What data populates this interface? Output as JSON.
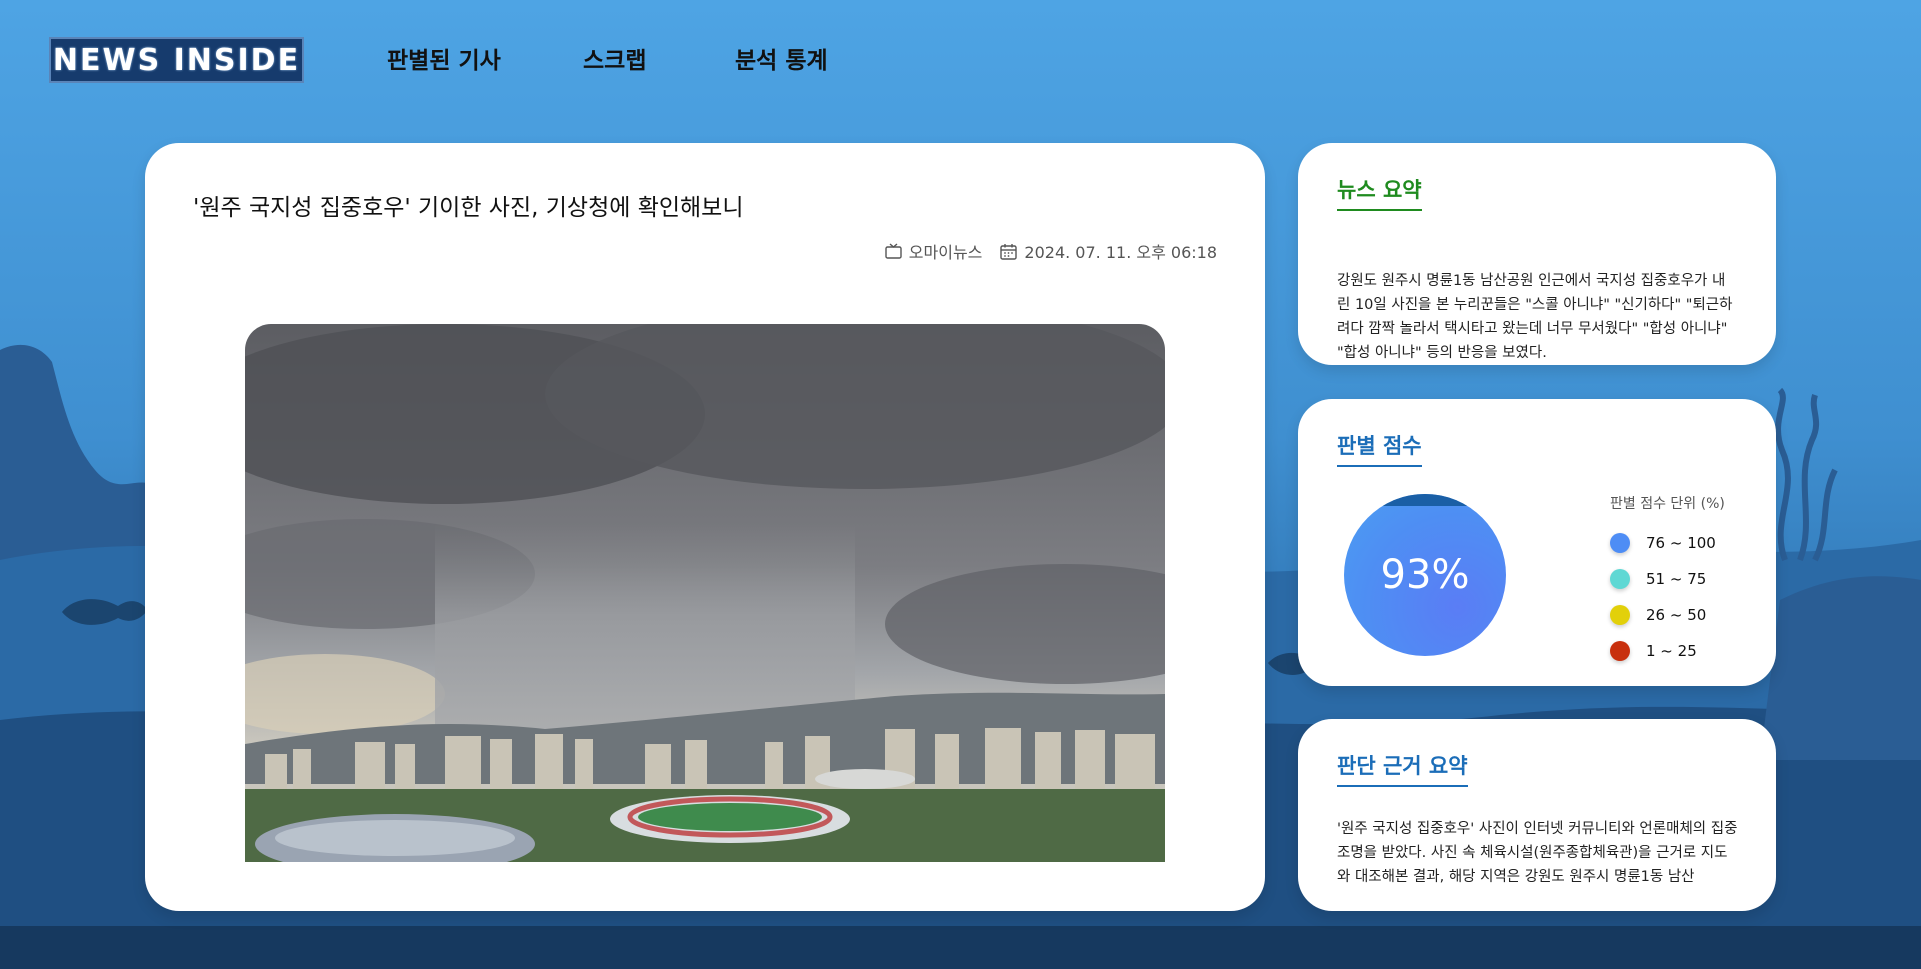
{
  "header": {
    "logo_text": "NEWS INSIDE",
    "nav": [
      "판별된 기사",
      "스크랩",
      "분석 통계"
    ]
  },
  "article": {
    "title": "'원주 국지성 집중호우' 기이한 사진, 기상청에 확인해보니",
    "source": "오마이뉴스",
    "datetime": "2024. 07. 11. 오후 06:18",
    "image_subject": "storm-cloud-rain-over-city-photo"
  },
  "summary_card": {
    "title": "뉴스 요약",
    "title_color": "#1f8b1f",
    "text": "강원도 원주시 명륜1동 남산공원 인근에서 국지성 집중호우가 내린 10일 사진을 본 누리꾼들은 \"스콜 아니냐\" \"신기하다\" \"퇴근하려다 깜짝 놀라서 택시타고 왔는데 너무 무서웠다\" \"합성 아니냐\" \"합성 아니냐\" 등의 반응을 보였다."
  },
  "score_card": {
    "title": "판별 점수",
    "title_color": "#1b6db8",
    "score": "93%",
    "legend_title": "판별 점수 단위 (%)",
    "legend": [
      {
        "label": "76 ~ 100",
        "color": "#4e8df5"
      },
      {
        "label": "51 ~ 75",
        "color": "#5fd8d4"
      },
      {
        "label": "26 ~ 50",
        "color": "#e2d00a"
      },
      {
        "label": "1 ~ 25",
        "color": "#c8300e"
      }
    ]
  },
  "reason_card": {
    "title": "판단 근거 요약",
    "title_color": "#1b6db8",
    "text": "'원주 국지성 집중호우' 사진이 인터넷 커뮤니티와 언론매체의 집중 조명을 받았다. 사진 속 체육시설(원주종합체육관)을 근거로 지도와 대조해본 결과, 해당 지역은 강원도 원주시 명륜1동 남산"
  }
}
